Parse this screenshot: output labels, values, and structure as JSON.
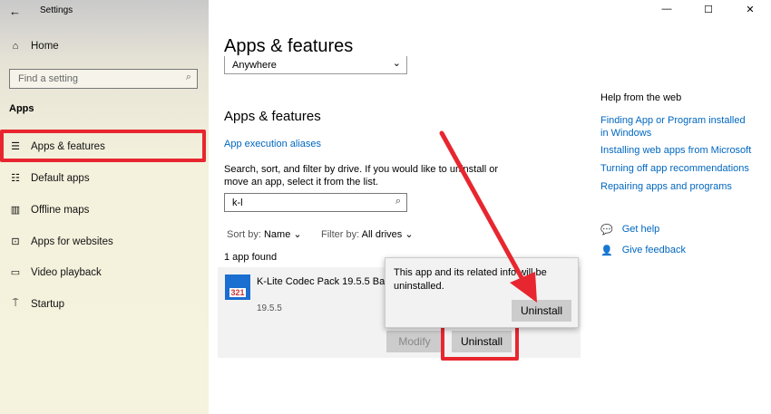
{
  "window": {
    "title": "Settings",
    "controls": [
      "—",
      "☐",
      "✕"
    ]
  },
  "sidebar": {
    "home": "Home",
    "search_placeholder": "Find a setting",
    "section": "Apps",
    "items": [
      {
        "label": "Apps & features",
        "icon": "list-icon"
      },
      {
        "label": "Default apps",
        "icon": "default-apps-icon"
      },
      {
        "label": "Offline maps",
        "icon": "map-icon"
      },
      {
        "label": "Apps for websites",
        "icon": "website-icon"
      },
      {
        "label": "Video playback",
        "icon": "video-icon"
      },
      {
        "label": "Startup",
        "icon": "startup-icon"
      }
    ]
  },
  "main": {
    "title": "Apps & features",
    "dropdown_value": "Anywhere",
    "section_title": "Apps & features",
    "aliases_link": "App execution aliases",
    "description": "Search, sort, and filter by drive. If you would like to uninstall or move an app, select it from the list.",
    "search_value": "k-l",
    "sort_label": "Sort by:",
    "sort_value": "Name",
    "filter_label": "Filter by:",
    "filter_value": "All drives",
    "count": "1 app found",
    "app": {
      "name": "K-Lite Codec Pack 19.5.5 Basic",
      "version": "19.5.5",
      "icon_text": "321",
      "modify": "Modify",
      "uninstall": "Uninstall"
    },
    "popup": {
      "text": "This app and its related info will be uninstalled.",
      "button": "Uninstall"
    }
  },
  "help": {
    "title": "Help from the web",
    "links": [
      "Finding App or Program installed in Windows",
      "Installing web apps from Microsoft",
      "Turning off app recommendations",
      "Repairing apps and programs"
    ],
    "get_help": "Get help",
    "feedback": "Give feedback"
  },
  "colors": {
    "accent": "#0067c0",
    "highlight": "#e8262f"
  }
}
